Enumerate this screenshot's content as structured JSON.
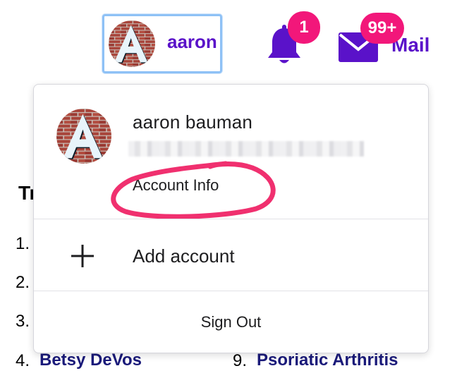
{
  "header": {
    "profile_name": "aaron",
    "notifications_count": "1",
    "mail_count": "99+",
    "mail_label": "Mail",
    "accent_color": "#5a12c9",
    "badge_color": "#f2177a"
  },
  "background_page": {
    "heading_partial": "Tr",
    "list_numbers": [
      "1.",
      "2.",
      "3.",
      "4."
    ],
    "visible_items": [
      {
        "number": "4.",
        "label": "Betsy DeVos"
      },
      {
        "number": "9.",
        "label": "Psoriatic Arthritis"
      }
    ]
  },
  "account_menu": {
    "user_name": "aaron bauman",
    "account_info_label": "Account Info",
    "add_account_label": "Add account",
    "sign_out_label": "Sign Out",
    "annotation_color": "#f0306f"
  },
  "icons": [
    "avatar-letter-a",
    "bell-icon",
    "mail-icon",
    "plus-icon"
  ]
}
